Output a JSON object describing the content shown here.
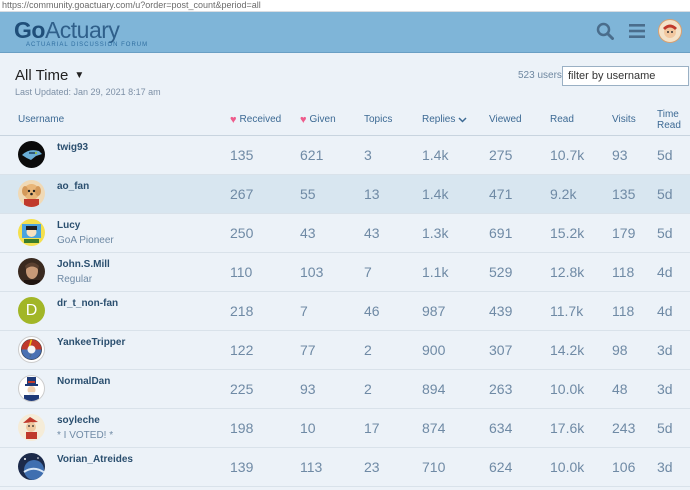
{
  "browser": {
    "url": "https://community.goactuary.com/u?order=post_count&period=all"
  },
  "header": {
    "logo_go": "Go",
    "logo_actuary": "Actuary",
    "logo_tagline": "ACTUARIAL DISCUSSION FORUM",
    "brand_color": "#7fb5d8"
  },
  "topbar": {
    "period": "All Time",
    "last_updated": "Last Updated: Jan 29, 2021 8:17 am",
    "user_count": "523 users",
    "filter_placeholder": "filter by username"
  },
  "columns": {
    "username": "Username",
    "received": "Received",
    "given": "Given",
    "topics": "Topics",
    "replies": "Replies",
    "viewed": "Viewed",
    "read": "Read",
    "visits": "Visits",
    "time_read": "Time Read"
  },
  "rows": [
    {
      "username": "twig93",
      "title": "",
      "avatar": "seahawks-logo",
      "received": "135",
      "given": "621",
      "topics": "3",
      "replies": "1.4k",
      "viewed": "275",
      "read": "10.7k",
      "visits": "93",
      "time_read": "5d"
    },
    {
      "username": "ao_fan",
      "title": "",
      "avatar": "dog-photo",
      "received": "267",
      "given": "55",
      "topics": "13",
      "replies": "1.4k",
      "viewed": "471",
      "read": "9.2k",
      "visits": "135",
      "time_read": "5d"
    },
    {
      "username": "Lucy",
      "title": "GoA Pioneer",
      "avatar": "cartoon-character",
      "received": "250",
      "given": "43",
      "topics": "43",
      "replies": "1.3k",
      "viewed": "691",
      "read": "15.2k",
      "visits": "179",
      "time_read": "5d"
    },
    {
      "username": "John.S.Mill",
      "title": "Regular",
      "avatar": "portrait-photo",
      "received": "110",
      "given": "103",
      "topics": "7",
      "replies": "1.1k",
      "viewed": "529",
      "read": "12.8k",
      "visits": "118",
      "time_read": "4d"
    },
    {
      "username": "dr_t_non-fan",
      "title": "",
      "avatar": "letter-d",
      "received": "218",
      "given": "7",
      "topics": "46",
      "replies": "987",
      "viewed": "439",
      "read": "11.7k",
      "visits": "118",
      "time_read": "4d"
    },
    {
      "username": "YankeeTripper",
      "title": "",
      "avatar": "steal-your-face-logo",
      "received": "122",
      "given": "77",
      "topics": "2",
      "replies": "900",
      "viewed": "307",
      "read": "14.2k",
      "visits": "98",
      "time_read": "3d"
    },
    {
      "username": "NormalDan",
      "title": "",
      "avatar": "uncle-sam",
      "received": "225",
      "given": "93",
      "topics": "2",
      "replies": "894",
      "viewed": "263",
      "read": "10.0k",
      "visits": "48",
      "time_read": "3d"
    },
    {
      "username": "soyleche",
      "title": "* I VOTED! *",
      "avatar": "cartoon-voted",
      "received": "198",
      "given": "10",
      "topics": "17",
      "replies": "874",
      "viewed": "634",
      "read": "17.6k",
      "visits": "243",
      "time_read": "5d"
    },
    {
      "username": "Vorian_Atreides",
      "title": "",
      "avatar": "planet-image",
      "received": "139",
      "given": "113",
      "topics": "23",
      "replies": "710",
      "viewed": "624",
      "read": "10.0k",
      "visits": "106",
      "time_read": "3d"
    }
  ]
}
